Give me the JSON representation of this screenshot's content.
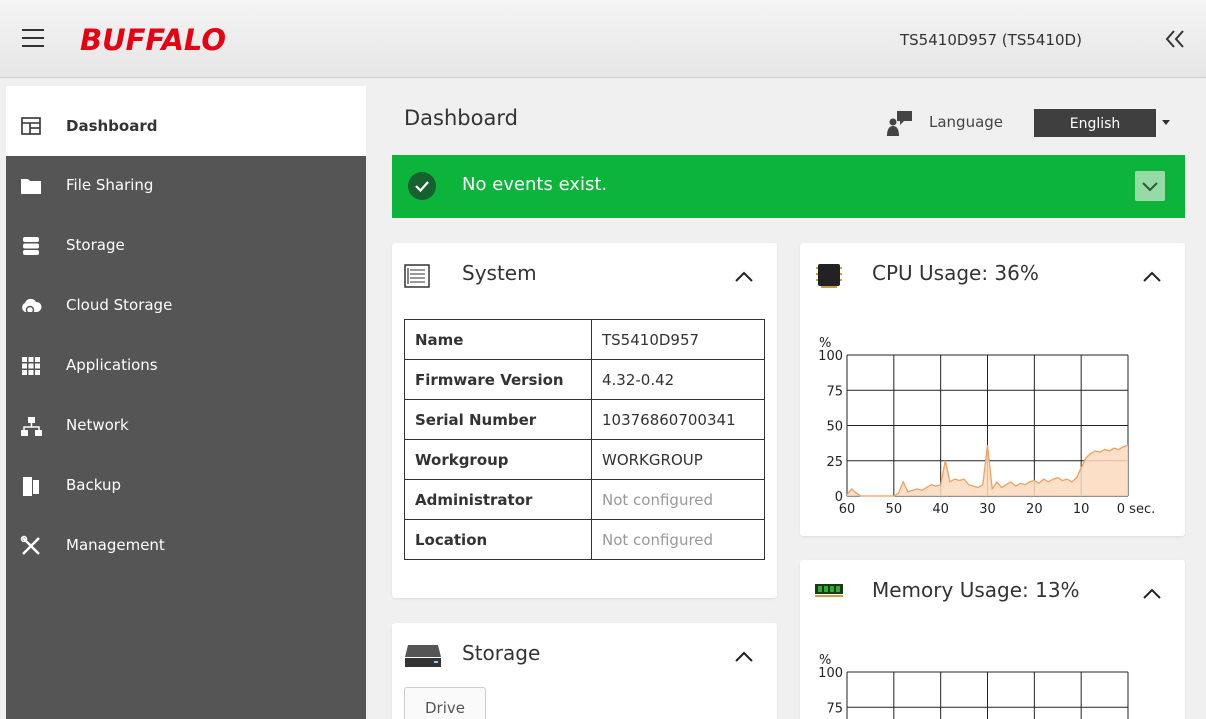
{
  "header": {
    "logo_text": "BUFFALO",
    "device_name": "TS5410D957 (TS5410D)"
  },
  "sidebar": {
    "items": [
      {
        "label": "Dashboard",
        "icon": "dashboard-icon",
        "active": true
      },
      {
        "label": "File Sharing",
        "icon": "folder-icon"
      },
      {
        "label": "Storage",
        "icon": "database-icon"
      },
      {
        "label": "Cloud Storage",
        "icon": "cloud-icon"
      },
      {
        "label": "Applications",
        "icon": "grid-icon"
      },
      {
        "label": "Network",
        "icon": "network-icon"
      },
      {
        "label": "Backup",
        "icon": "backup-icon"
      },
      {
        "label": "Management",
        "icon": "tools-icon"
      }
    ]
  },
  "main": {
    "title": "Dashboard",
    "language_label": "Language",
    "language_value": "English",
    "events_text": "No events exist."
  },
  "system": {
    "title": "System",
    "rows": [
      {
        "key": "Name",
        "value": "TS5410D957",
        "muted": false
      },
      {
        "key": "Firmware Version",
        "value": "4.32-0.42",
        "muted": false
      },
      {
        "key": "Serial Number",
        "value": "10376860700341",
        "muted": false
      },
      {
        "key": "Workgroup",
        "value": "WORKGROUP",
        "muted": false
      },
      {
        "key": "Administrator",
        "value": "Not configured",
        "muted": true
      },
      {
        "key": "Location",
        "value": "Not configured",
        "muted": true
      }
    ]
  },
  "storage": {
    "title": "Storage",
    "drive_label": "Drive"
  },
  "cpu": {
    "title": "CPU Usage: 36%"
  },
  "memory": {
    "title": "Memory Usage: 13%"
  },
  "colors": {
    "sidebar_bg": "#555555",
    "events_green": "#0cb43c",
    "chart_line": "#f0a060",
    "chart_fill": "#fbd9bd"
  },
  "chart_data": [
    {
      "type": "area",
      "ylabel": "%",
      "ylim": [
        0,
        100
      ],
      "y_ticks": [
        0,
        25,
        50,
        75,
        100
      ],
      "x_ticks": [
        "60",
        "50",
        "40",
        "30",
        "20",
        "10",
        "0 sec."
      ],
      "x": [
        60,
        59,
        58,
        57,
        56,
        55,
        54,
        53,
        52,
        51,
        50,
        49,
        48,
        47,
        46,
        45,
        44,
        43,
        42,
        41,
        40,
        39,
        38,
        37,
        36,
        35,
        34,
        33,
        32,
        31,
        30,
        29,
        28,
        27,
        26,
        25,
        24,
        23,
        22,
        21,
        20,
        19,
        18,
        17,
        16,
        15,
        14,
        13,
        12,
        11,
        10,
        9,
        8,
        7,
        6,
        5,
        4,
        3,
        2,
        1,
        0
      ],
      "series": [
        {
          "values": [
            1,
            5,
            2,
            0,
            0,
            0,
            0,
            0,
            0,
            0,
            0,
            2,
            10,
            3,
            4,
            5,
            4,
            6,
            8,
            7,
            8,
            25,
            10,
            12,
            11,
            12,
            8,
            7,
            6,
            8,
            36,
            5,
            10,
            6,
            8,
            10,
            7,
            9,
            8,
            10,
            11,
            9,
            12,
            10,
            12,
            13,
            11,
            12,
            10,
            13,
            20,
            27,
            30,
            32,
            31,
            33,
            32,
            34,
            33,
            35,
            36
          ]
        }
      ]
    },
    {
      "type": "area",
      "ylabel": "%",
      "ylim": [
        0,
        100
      ],
      "y_ticks": [
        75,
        100
      ],
      "series": []
    }
  ]
}
